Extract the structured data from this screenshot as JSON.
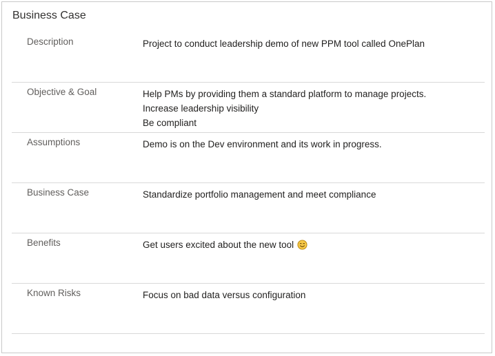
{
  "section": {
    "title": "Business Case"
  },
  "fields": [
    {
      "label": "Description",
      "lines": [
        "Project to conduct leadership demo of new PPM tool called OnePlan"
      ]
    },
    {
      "label": "Objective & Goal",
      "lines": [
        "Help PMs by providing them a standard platform to manage projects.",
        "Increase leadership visibility",
        "Be compliant"
      ]
    },
    {
      "label": "Assumptions",
      "lines": [
        "Demo is on the Dev environment and its work in progress."
      ]
    },
    {
      "label": "Business Case",
      "lines": [
        "Standardize portfolio management and meet compliance"
      ]
    },
    {
      "label": "Benefits",
      "lines": [
        "Get users excited about the new tool"
      ],
      "trailing_icon": "smiley-face-icon"
    },
    {
      "label": "Known Risks",
      "lines": [
        "Focus on bad data versus configuration"
      ]
    }
  ],
  "colors": {
    "label": "#605e5c",
    "value": "#201f1e",
    "divider": "#d8d8d8",
    "emoji_fill": "#f7c948",
    "emoji_stroke": "#b8860b"
  }
}
